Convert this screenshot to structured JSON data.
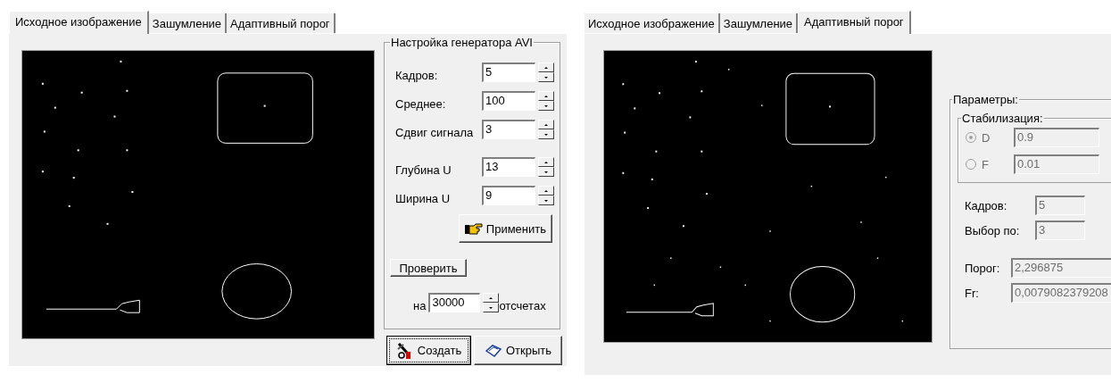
{
  "left_panel": {
    "tabs": [
      {
        "label": "Исходное изображение",
        "selected": true
      },
      {
        "label": "Зашумление",
        "selected": false
      },
      {
        "label": "Адаптивный порог",
        "selected": false
      }
    ],
    "generator_group": {
      "title": "Настройка генератора AVI",
      "fields": [
        {
          "label": "Кадров:",
          "value": "5"
        },
        {
          "label": "Среднее:",
          "value": "100"
        },
        {
          "label": "Сдвиг сигнала",
          "value": "3"
        },
        {
          "label": "Глубина U",
          "value": "13"
        },
        {
          "label": "Ширина U",
          "value": "9"
        }
      ],
      "apply_button": "Применить",
      "check_button": "Проверить",
      "samples": {
        "prefix": "на",
        "value": "30000",
        "suffix": "отсчетах"
      }
    },
    "buttons": [
      {
        "label": "Создать",
        "kind": "create",
        "focused": true
      },
      {
        "label": "Открыть",
        "kind": "open",
        "focused": false
      }
    ]
  },
  "right_panel": {
    "tabs": [
      {
        "label": "Исходное изображение",
        "selected": false
      },
      {
        "label": "Зашумление",
        "selected": false
      },
      {
        "label": "Адаптивный порог",
        "selected": true
      }
    ],
    "params_group": {
      "title": "Параметры:",
      "disabled": true,
      "stabilization": {
        "title": "Стабилизация:",
        "options": [
          {
            "label": "D",
            "value": "0.9",
            "selected": true
          },
          {
            "label": "F",
            "value": "0.01",
            "selected": false
          }
        ]
      },
      "fields": [
        {
          "label": "Кадров:",
          "value": "5"
        },
        {
          "label": "Выбор по:",
          "value": "3"
        }
      ],
      "results": [
        {
          "label": "Порог:",
          "value": "2,296875"
        },
        {
          "label": "Fr:",
          "value": "0,0079082379208"
        }
      ]
    }
  }
}
